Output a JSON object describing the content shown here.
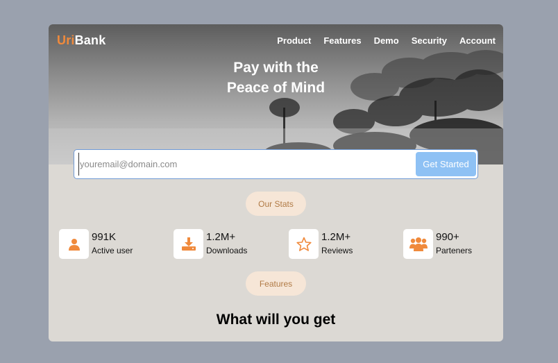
{
  "brand": {
    "part1": "Uri",
    "part2": "Bank",
    "accent_color": "#f08a3c"
  },
  "nav": {
    "items": [
      "Product",
      "Features",
      "Demo",
      "Security",
      "Account"
    ]
  },
  "hero": {
    "line1": "Pay with the",
    "line2": "Peace of Mind"
  },
  "signup": {
    "placeholder": "youremail@domain.com",
    "button_label": "Get Started"
  },
  "stats_pill": "Our Stats",
  "stats": [
    {
      "value": "991K",
      "label": "Active user",
      "icon": "user-icon"
    },
    {
      "value": "1.2M+",
      "label": "Downloads",
      "icon": "download-icon"
    },
    {
      "value": "1.2M+",
      "label": "Reviews",
      "icon": "star-icon"
    },
    {
      "value": "990+",
      "label": "Parteners",
      "icon": "users-group-icon"
    }
  ],
  "features_pill": "Features",
  "features_title": "What will you get"
}
